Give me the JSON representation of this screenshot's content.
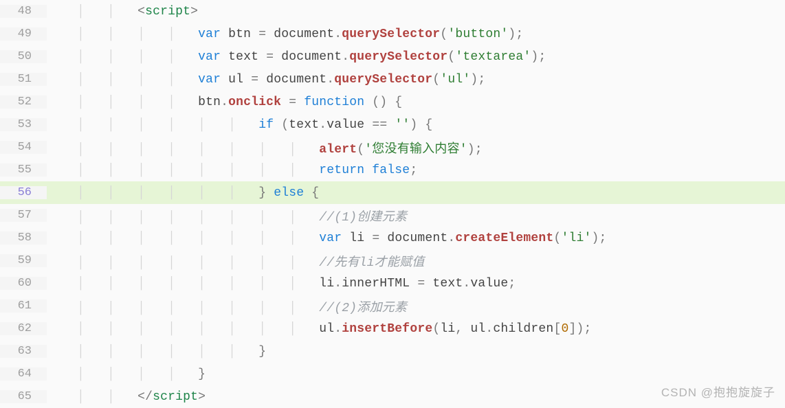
{
  "editor": {
    "highlighted_line": 56,
    "gutter": [
      "48",
      "49",
      "50",
      "51",
      "52",
      "53",
      "54",
      "55",
      "56",
      "57",
      "58",
      "59",
      "60",
      "61",
      "62",
      "63",
      "64",
      "65"
    ],
    "indent_guides_per_line": [
      2,
      4,
      4,
      4,
      4,
      6,
      8,
      8,
      6,
      8,
      8,
      8,
      8,
      8,
      8,
      6,
      4,
      2
    ],
    "lines": [
      [
        {
          "cls": "punc",
          "t": "<"
        },
        {
          "cls": "tag",
          "t": "script"
        },
        {
          "cls": "punc",
          "t": ">"
        }
      ],
      [
        {
          "cls": "kw",
          "t": "var"
        },
        {
          "cls": "",
          "t": " "
        },
        {
          "cls": "id",
          "t": "btn"
        },
        {
          "cls": "",
          "t": " "
        },
        {
          "cls": "op",
          "t": "="
        },
        {
          "cls": "",
          "t": " "
        },
        {
          "cls": "obj",
          "t": "document"
        },
        {
          "cls": "punc",
          "t": "."
        },
        {
          "cls": "fn",
          "t": "querySelector"
        },
        {
          "cls": "punc",
          "t": "("
        },
        {
          "cls": "str",
          "t": "'button'"
        },
        {
          "cls": "punc",
          "t": ")"
        },
        {
          "cls": "punc",
          "t": ";"
        }
      ],
      [
        {
          "cls": "kw",
          "t": "var"
        },
        {
          "cls": "",
          "t": " "
        },
        {
          "cls": "id",
          "t": "text"
        },
        {
          "cls": "",
          "t": " "
        },
        {
          "cls": "op",
          "t": "="
        },
        {
          "cls": "",
          "t": " "
        },
        {
          "cls": "obj",
          "t": "document"
        },
        {
          "cls": "punc",
          "t": "."
        },
        {
          "cls": "fn",
          "t": "querySelector"
        },
        {
          "cls": "punc",
          "t": "("
        },
        {
          "cls": "str",
          "t": "'textarea'"
        },
        {
          "cls": "punc",
          "t": ")"
        },
        {
          "cls": "punc",
          "t": ";"
        }
      ],
      [
        {
          "cls": "kw",
          "t": "var"
        },
        {
          "cls": "",
          "t": " "
        },
        {
          "cls": "id",
          "t": "ul"
        },
        {
          "cls": "",
          "t": " "
        },
        {
          "cls": "op",
          "t": "="
        },
        {
          "cls": "",
          "t": " "
        },
        {
          "cls": "obj",
          "t": "document"
        },
        {
          "cls": "punc",
          "t": "."
        },
        {
          "cls": "fn",
          "t": "querySelector"
        },
        {
          "cls": "punc",
          "t": "("
        },
        {
          "cls": "str",
          "t": "'ul'"
        },
        {
          "cls": "punc",
          "t": ")"
        },
        {
          "cls": "punc",
          "t": ";"
        }
      ],
      [
        {
          "cls": "id",
          "t": "btn"
        },
        {
          "cls": "punc",
          "t": "."
        },
        {
          "cls": "fn",
          "t": "onclick"
        },
        {
          "cls": "",
          "t": " "
        },
        {
          "cls": "op",
          "t": "="
        },
        {
          "cls": "",
          "t": " "
        },
        {
          "cls": "kw",
          "t": "function"
        },
        {
          "cls": "",
          "t": " "
        },
        {
          "cls": "punc",
          "t": "()"
        },
        {
          "cls": "",
          "t": " "
        },
        {
          "cls": "punc",
          "t": "{"
        }
      ],
      [
        {
          "cls": "kw",
          "t": "if"
        },
        {
          "cls": "",
          "t": " "
        },
        {
          "cls": "punc",
          "t": "("
        },
        {
          "cls": "id",
          "t": "text"
        },
        {
          "cls": "punc",
          "t": "."
        },
        {
          "cls": "prop",
          "t": "value"
        },
        {
          "cls": "",
          "t": " "
        },
        {
          "cls": "op",
          "t": "=="
        },
        {
          "cls": "",
          "t": " "
        },
        {
          "cls": "str",
          "t": "''"
        },
        {
          "cls": "punc",
          "t": ")"
        },
        {
          "cls": "",
          "t": " "
        },
        {
          "cls": "punc",
          "t": "{"
        }
      ],
      [
        {
          "cls": "fn",
          "t": "alert"
        },
        {
          "cls": "punc",
          "t": "("
        },
        {
          "cls": "str",
          "t": "'您没有输入内容'"
        },
        {
          "cls": "punc",
          "t": ")"
        },
        {
          "cls": "punc",
          "t": ";"
        }
      ],
      [
        {
          "cls": "kw",
          "t": "return"
        },
        {
          "cls": "",
          "t": " "
        },
        {
          "cls": "bool",
          "t": "false"
        },
        {
          "cls": "punc",
          "t": ";"
        }
      ],
      [
        {
          "cls": "punc",
          "t": "}"
        },
        {
          "cls": "",
          "t": " "
        },
        {
          "cls": "kw",
          "t": "else"
        },
        {
          "cls": "",
          "t": " "
        },
        {
          "cls": "punc",
          "t": "{"
        }
      ],
      [
        {
          "cls": "cmt",
          "t": "//(1)创建元素"
        }
      ],
      [
        {
          "cls": "kw",
          "t": "var"
        },
        {
          "cls": "",
          "t": " "
        },
        {
          "cls": "id",
          "t": "li"
        },
        {
          "cls": "",
          "t": " "
        },
        {
          "cls": "op",
          "t": "="
        },
        {
          "cls": "",
          "t": " "
        },
        {
          "cls": "obj",
          "t": "document"
        },
        {
          "cls": "punc",
          "t": "."
        },
        {
          "cls": "fn",
          "t": "createElement"
        },
        {
          "cls": "punc",
          "t": "("
        },
        {
          "cls": "str",
          "t": "'li'"
        },
        {
          "cls": "punc",
          "t": ")"
        },
        {
          "cls": "punc",
          "t": ";"
        }
      ],
      [
        {
          "cls": "cmt",
          "t": "//先有li才能赋值"
        }
      ],
      [
        {
          "cls": "id",
          "t": "li"
        },
        {
          "cls": "punc",
          "t": "."
        },
        {
          "cls": "prop",
          "t": "innerHTML"
        },
        {
          "cls": "",
          "t": " "
        },
        {
          "cls": "op",
          "t": "="
        },
        {
          "cls": "",
          "t": " "
        },
        {
          "cls": "id",
          "t": "text"
        },
        {
          "cls": "punc",
          "t": "."
        },
        {
          "cls": "prop",
          "t": "value"
        },
        {
          "cls": "punc",
          "t": ";"
        }
      ],
      [
        {
          "cls": "cmt",
          "t": "//(2)添加元素"
        }
      ],
      [
        {
          "cls": "id",
          "t": "ul"
        },
        {
          "cls": "punc",
          "t": "."
        },
        {
          "cls": "fn",
          "t": "insertBefore"
        },
        {
          "cls": "punc",
          "t": "("
        },
        {
          "cls": "id",
          "t": "li"
        },
        {
          "cls": "punc",
          "t": ","
        },
        {
          "cls": "",
          "t": " "
        },
        {
          "cls": "id",
          "t": "ul"
        },
        {
          "cls": "punc",
          "t": "."
        },
        {
          "cls": "prop",
          "t": "children"
        },
        {
          "cls": "punc",
          "t": "["
        },
        {
          "cls": "num",
          "t": "0"
        },
        {
          "cls": "punc",
          "t": "]"
        },
        {
          "cls": "punc",
          "t": ")"
        },
        {
          "cls": "punc",
          "t": ";"
        }
      ],
      [
        {
          "cls": "punc",
          "t": "}"
        }
      ],
      [
        {
          "cls": "punc",
          "t": "}"
        }
      ],
      [
        {
          "cls": "punc",
          "t": "</"
        },
        {
          "cls": "tag",
          "t": "script"
        },
        {
          "cls": "punc",
          "t": ">"
        }
      ]
    ]
  },
  "watermark": "CSDN @抱抱旋旋子"
}
